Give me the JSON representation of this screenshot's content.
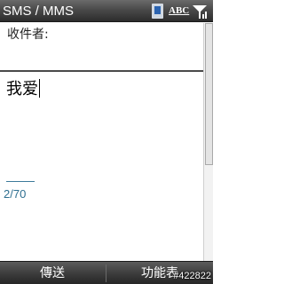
{
  "titlebar": {
    "title": "SMS / MMS",
    "input_mode": "ABC",
    "icons": [
      "device-icon",
      "signal-icon"
    ]
  },
  "recipient": {
    "label": "收件者:",
    "value": ""
  },
  "message": {
    "text": "我爱",
    "char_counter": "2/70"
  },
  "softkeys": {
    "left": "傳送",
    "right": "功能表"
  },
  "watermark": "#422822",
  "colors": {
    "titlebar": "#4a4a4a",
    "counter_text": "#2e6f90"
  }
}
